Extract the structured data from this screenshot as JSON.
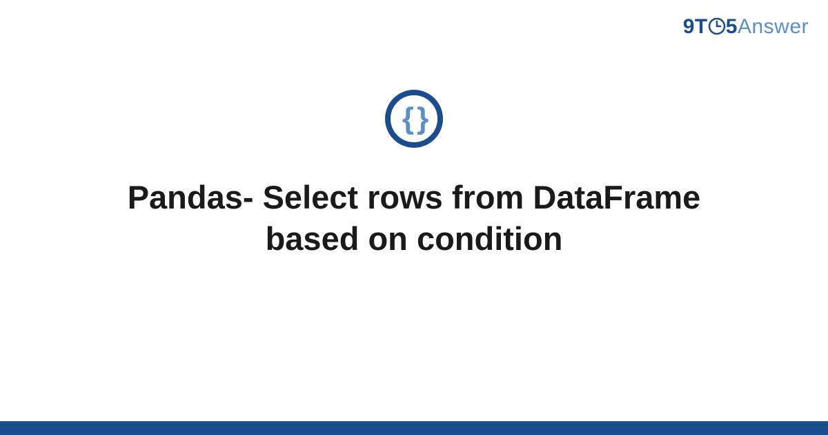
{
  "brand": {
    "part1": "9T",
    "part2": "5",
    "part3": "Answer"
  },
  "icon": {
    "braces": "{ }"
  },
  "title": "Pandas- Select rows from DataFrame based on condition",
  "colors": {
    "primary": "#1a4d8f",
    "secondary": "#5a8fc7"
  }
}
